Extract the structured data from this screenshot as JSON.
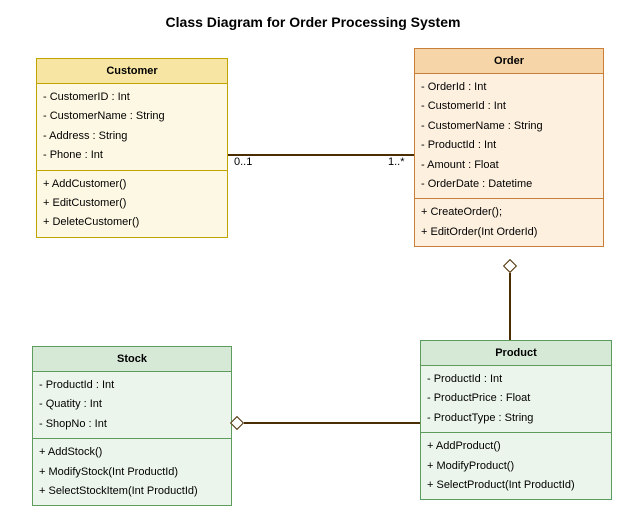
{
  "title": "Class Diagram for Order Processing System",
  "classes": {
    "customer": {
      "name": "Customer",
      "attributes": [
        "- CustomerID : Int",
        "- CustomerName : String",
        "- Address : String",
        "- Phone : Int"
      ],
      "methods": [
        "+ AddCustomer()",
        "+ EditCustomer()",
        "+ DeleteCustomer()"
      ]
    },
    "order": {
      "name": "Order",
      "attributes": [
        "- OrderId : Int",
        " - CustomerId : Int",
        "- CustomerName : String",
        "- ProductId : Int",
        "- Amount : Float",
        "- OrderDate : Datetime"
      ],
      "methods": [
        "+ CreateOrder();",
        "+ EditOrder(Int OrderId)"
      ]
    },
    "stock": {
      "name": "Stock",
      "attributes": [
        "- ProductId : Int",
        "- Quatity : Int",
        "- ShopNo : Int"
      ],
      "methods": [
        "+ AddStock()",
        "+ ModifyStock(Int ProductId)",
        "+ SelectStockItem(Int ProductId)"
      ]
    },
    "product": {
      "name": "Product",
      "attributes": [
        "- ProductId : Int",
        "- ProductPrice : Float",
        "- ProductType : String"
      ],
      "methods": [
        "+ AddProduct()",
        "+ ModifyProduct()",
        "+ SelectProduct(Int ProductId)"
      ]
    }
  },
  "multiplicities": {
    "customer_order_left": "0..1",
    "customer_order_right": "1..*"
  },
  "relations": [
    {
      "from": "Customer",
      "to": "Order",
      "type": "association",
      "from_mult": "0..1",
      "to_mult": "1..*"
    },
    {
      "from": "Order",
      "to": "Product",
      "type": "aggregation"
    },
    {
      "from": "Stock",
      "to": "Product",
      "type": "aggregation"
    }
  ]
}
